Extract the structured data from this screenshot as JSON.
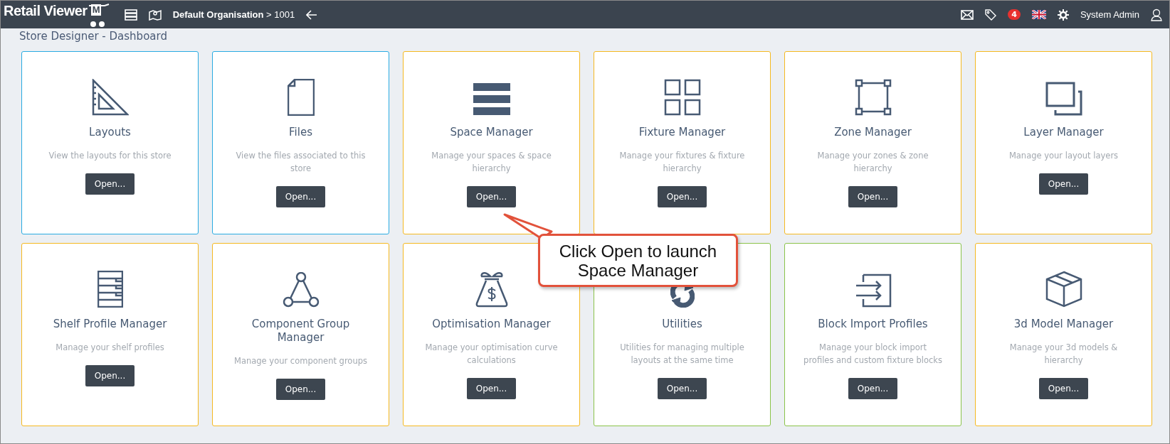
{
  "header": {
    "logo_text": "Retail Viewer",
    "logo_mark": "M",
    "breadcrumb": "**Default Organisation** > 1001",
    "notification_count": "4",
    "user_name": "System Admin"
  },
  "page_title": "Store Designer - Dashboard",
  "cards": [
    {
      "title": "Layouts",
      "description": "View the layouts for this store",
      "button": "Open...",
      "color": "#29abe2"
    },
    {
      "title": "Files",
      "description": "View the files associated to this store",
      "button": "Open...",
      "color": "#29abe2"
    },
    {
      "title": "Space Manager",
      "description": "Manage your spaces & space hierarchy",
      "button": "Open...",
      "color": "#f5b921"
    },
    {
      "title": "Fixture Manager",
      "description": "Manage your fixtures & fixture hierarchy",
      "button": "Open...",
      "color": "#f5b921"
    },
    {
      "title": "Zone Manager",
      "description": "Manage your zones & zone hierarchy",
      "button": "Open...",
      "color": "#f5b921"
    },
    {
      "title": "Layer Manager",
      "description": "Manage your layout layers",
      "button": "Open...",
      "color": "#f5b921"
    },
    {
      "title": "Shelf Profile Manager",
      "description": "Manage your shelf profiles",
      "button": "Open...",
      "color": "#f5b921"
    },
    {
      "title": "Component Group Manager",
      "description": "Manage your component groups",
      "button": "Open...",
      "color": "#f5b921"
    },
    {
      "title": "Optimisation Manager",
      "description": "Manage your optimisation curve calculations",
      "button": "Open...",
      "color": "#f5b921"
    },
    {
      "title": "Utilities",
      "description": "Utilities for managing multiple layouts at the same time",
      "button": "Open...",
      "color": "#8bc34a"
    },
    {
      "title": "Block Import Profiles",
      "description": "Manage your block import profiles and custom fixture blocks",
      "button": "Open...",
      "color": "#8bc34a"
    },
    {
      "title": "3d Model Manager",
      "description": "Manage your 3d models & hierarchy",
      "button": "Open...",
      "color": "#f5b921"
    }
  ],
  "callout": {
    "text": "Click Open to launch Space Manager"
  }
}
